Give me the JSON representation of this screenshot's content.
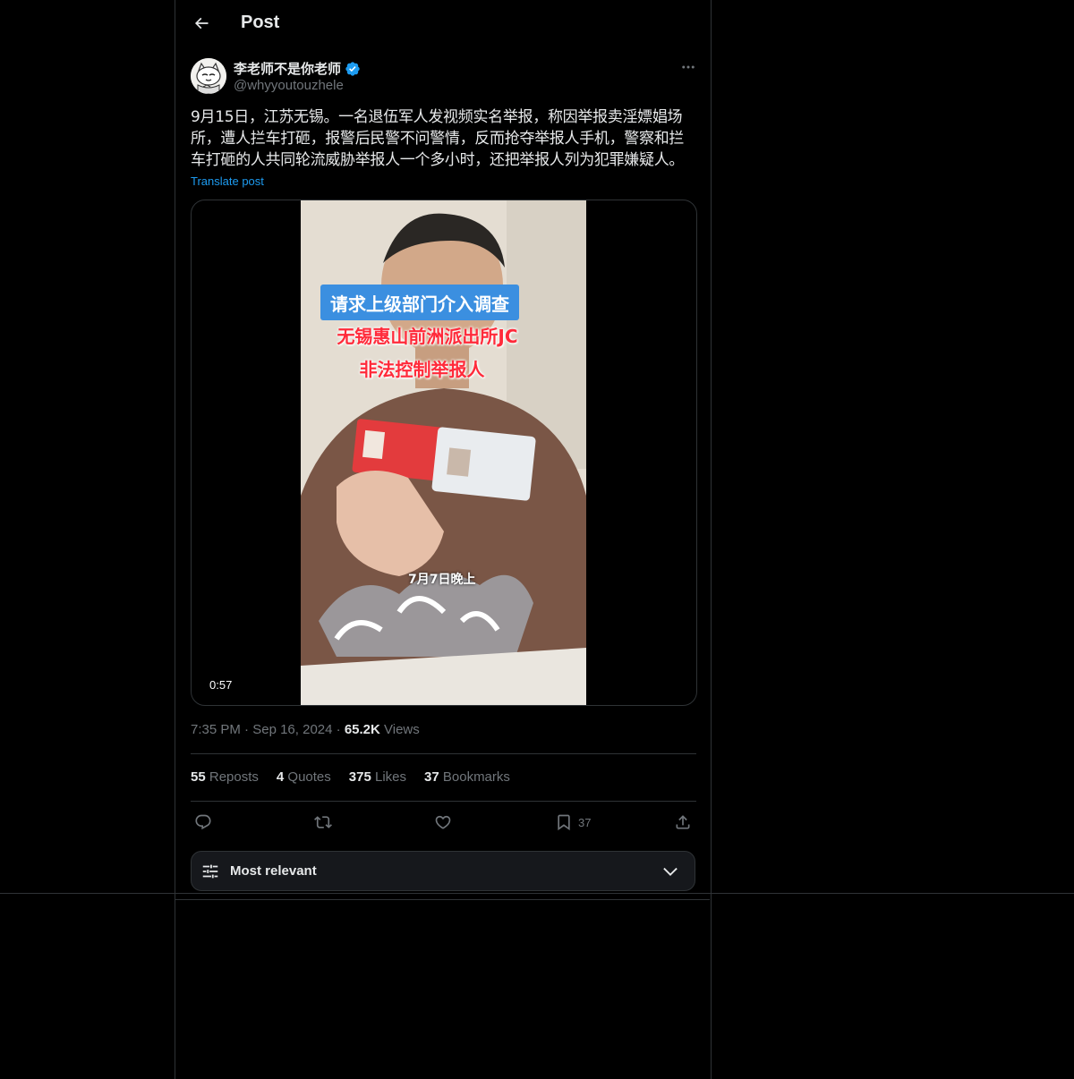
{
  "header": {
    "title": "Post"
  },
  "author": {
    "name": "李老师不是你老师",
    "handle": "@whyyoutouzhele",
    "verified": true
  },
  "post": {
    "text": "9月15日，江苏无锡。一名退伍军人发视频实名举报，称因举报卖淫嫖娼场所，遭人拦车打砸，报警后民警不问警情，反而抢夺举报人手机，警察和拦车打砸的人共同轮流威胁举报人一个多小时，还把举报人列为犯罪嫌疑人。",
    "translate_label": "Translate post",
    "video": {
      "duration": "0:57",
      "caption_1": "请求上级部门介入调查",
      "caption_2": "无锡惠山前洲派出所JC",
      "caption_3": "非法控制举报人",
      "caption_4": "7月7日晚上"
    },
    "time": "7:35 PM",
    "date": "Sep 16, 2024",
    "views_count": "65.2K",
    "views_label": "Views"
  },
  "stats": {
    "reposts_count": "55",
    "reposts_label": "Reposts",
    "quotes_count": "4",
    "quotes_label": "Quotes",
    "likes_count": "375",
    "likes_label": "Likes",
    "bookmarks_count": "37",
    "bookmarks_label": "Bookmarks"
  },
  "actions": {
    "bookmark_count": "37"
  },
  "sort": {
    "label": "Most relevant"
  },
  "colors": {
    "background": "#000000",
    "text": "#e7e9ea",
    "muted": "#71767b",
    "accent": "#1d9bf0",
    "border": "#2f3336"
  }
}
